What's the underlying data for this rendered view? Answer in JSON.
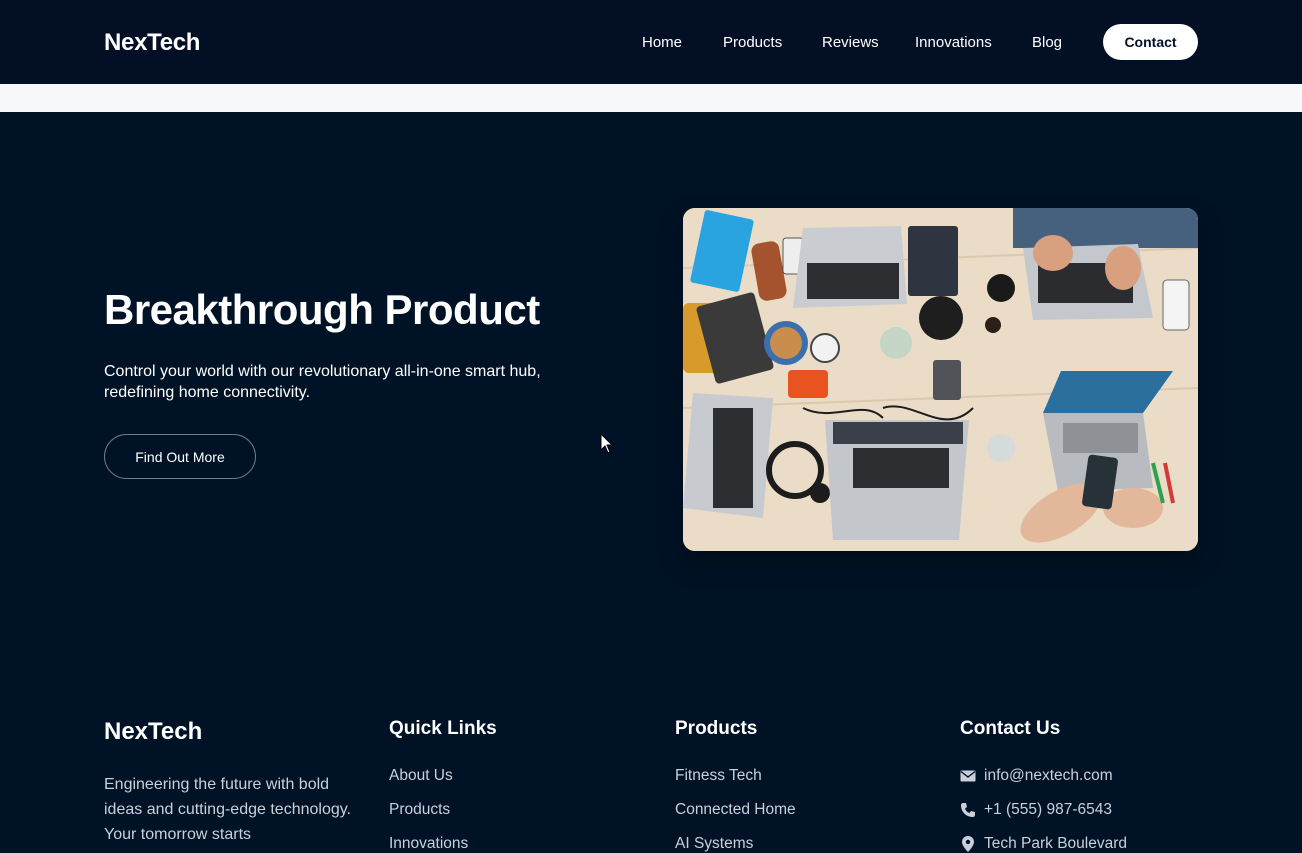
{
  "nav": {
    "brand": "NexTech",
    "links": [
      "Home",
      "Products",
      "Reviews",
      "Innovations",
      "Blog"
    ],
    "contact_label": "Contact"
  },
  "hero": {
    "title": "Breakthrough Product",
    "description": "Control your world with our revolutionary all-in-one smart hub, redefining home connectivity.",
    "cta_label": "Find Out More"
  },
  "footer": {
    "brand": "NexTech",
    "description": "Engineering the future with bold ideas and cutting-edge technology. Your tomorrow starts",
    "quick_links": {
      "heading": "Quick Links",
      "items": [
        "About Us",
        "Products",
        "Innovations"
      ]
    },
    "products": {
      "heading": "Products",
      "items": [
        "Fitness Tech",
        "Connected Home",
        "AI Systems"
      ]
    },
    "contact": {
      "heading": "Contact Us",
      "email": "info@nextech.com",
      "phone": "+1 (555) 987-6543",
      "address": "Tech Park Boulevard"
    }
  },
  "colors": {
    "nav_bg": "#020f25",
    "page_bg": "#001226",
    "strip_bg": "#f7f8fa",
    "button_bg": "#ffffff"
  },
  "icons": [
    "envelope-icon",
    "phone-icon",
    "location-pin-icon",
    "mouse-cursor-icon"
  ]
}
